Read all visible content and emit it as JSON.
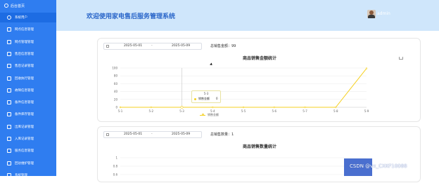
{
  "sidebar": {
    "brand": "后台首页",
    "items": [
      {
        "label": "系统用户"
      },
      {
        "label": "网点信息管理"
      },
      {
        "label": "网点管理管理"
      },
      {
        "label": "售后信息管理"
      },
      {
        "label": "售后记录管理"
      },
      {
        "label": "回收执行管理"
      },
      {
        "label": "故障信息管理"
      },
      {
        "label": "备件信息管理"
      },
      {
        "label": "备件库存管理"
      },
      {
        "label": "出库记录管理"
      },
      {
        "label": "入库记录管理"
      },
      {
        "label": "服务信息管理"
      },
      {
        "label": "回访维护管理"
      },
      {
        "label": "系统管理"
      }
    ]
  },
  "header": {
    "title": "欢迎使用家电售后服务管理系统",
    "username": "admin"
  },
  "panel1": {
    "date_start": "2025-05-01",
    "date_sep": "-",
    "date_end": "2025-05-09",
    "total_text": "总销售金额：99",
    "chart_title": "商品销售金额统计",
    "tooltip": {
      "header": "5-3",
      "series": "销售金额",
      "value": "0"
    },
    "legend": "销售金额"
  },
  "panel2": {
    "date_start": "2025-05-01",
    "date_sep": "-",
    "date_end": "2025-05-09",
    "total_text": "总销售数量：1",
    "chart_title": "商品销售数量统计"
  },
  "watermark": "CSDN @vx_CXKF10088",
  "colors": {
    "sidebar": "#2f7df0",
    "header": "#cfe6fb",
    "series": "#f5d020",
    "title": "#2a66c9"
  },
  "chart_data": [
    {
      "type": "line",
      "title": "商品销售金额统计",
      "categories": [
        "5-1",
        "5-2",
        "5-3",
        "5-4",
        "5-5",
        "5-6",
        "5-7",
        "5-8",
        "5-9"
      ],
      "series": [
        {
          "name": "销售金额",
          "values": [
            0,
            0,
            0,
            0,
            0,
            0,
            0,
            0,
            99
          ]
        }
      ],
      "ylim": [
        0,
        100
      ],
      "yticks": [
        0,
        20,
        40,
        60,
        80,
        100
      ],
      "grid": true,
      "legend": "bottom"
    },
    {
      "type": "line",
      "title": "商品销售数量统计",
      "yticks": [
        "1",
        "0.8",
        "0.6"
      ]
    }
  ],
  "icons": [
    "home-icon",
    "user-icon",
    "calendar-icon",
    "download-icon"
  ]
}
